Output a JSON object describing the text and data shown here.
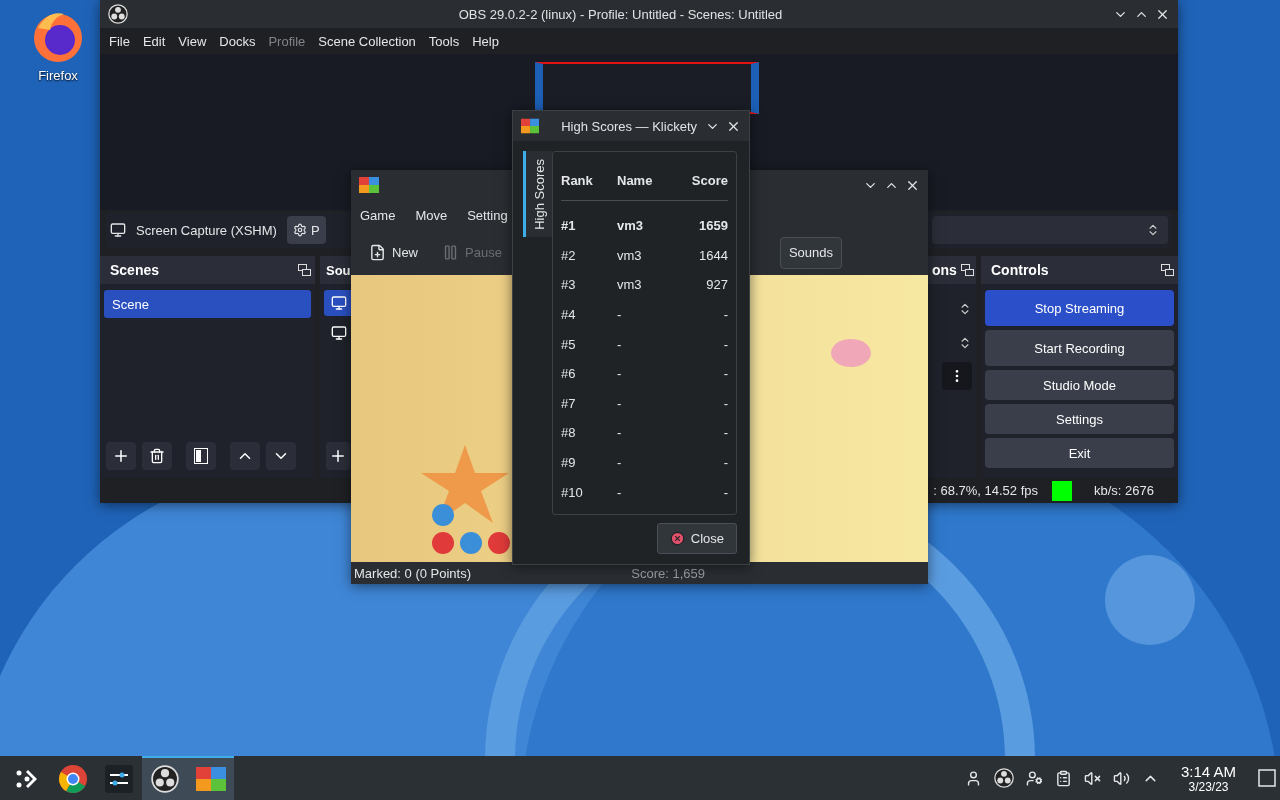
{
  "desktop": {
    "icons": [
      {
        "label": "Firefox"
      }
    ]
  },
  "obs": {
    "title": "OBS 29.0.2-2 (linux) - Profile: Untitled - Scenes: Untitled",
    "menu": [
      {
        "label": "File",
        "disabled": false
      },
      {
        "label": "Edit",
        "disabled": false
      },
      {
        "label": "View",
        "disabled": false
      },
      {
        "label": "Docks",
        "disabled": false
      },
      {
        "label": "Profile",
        "disabled": true
      },
      {
        "label": "Scene Collection",
        "disabled": false
      },
      {
        "label": "Tools",
        "disabled": false
      },
      {
        "label": "Help",
        "disabled": false
      }
    ],
    "source_toolbar": {
      "source": "Screen Capture (XSHM)",
      "properties": "P"
    },
    "scenes": {
      "title": "Scenes",
      "items": [
        {
          "label": "Scene",
          "selected": true
        }
      ]
    },
    "sources": {
      "title": "Sou",
      "items": [
        {
          "selected": true
        },
        {
          "selected": false
        }
      ]
    },
    "transitions": {
      "title": "ons"
    },
    "controls": {
      "title": "Controls",
      "buttons": [
        {
          "label": "Stop Streaming",
          "active": true
        },
        {
          "label": "Start Recording",
          "active": false
        },
        {
          "label": "Studio Mode",
          "active": false
        },
        {
          "label": "Settings",
          "active": false
        },
        {
          "label": "Exit",
          "active": false
        }
      ]
    },
    "status": {
      "performance": ": 68.7%, 14.52 fps",
      "bitrate": "kb/s: 2676"
    }
  },
  "klickety": {
    "menu": [
      "Game",
      "Move",
      "Setting"
    ],
    "toolbar": [
      {
        "label": "New",
        "disabled": false
      },
      {
        "label": "Pause",
        "disabled": true
      },
      {
        "label": "Sounds",
        "disabled": false
      }
    ],
    "status_left": "Marked: 0 (0 Points)",
    "status_right": "Score: 1,659"
  },
  "high_scores": {
    "title": "High Scores — Klickety",
    "tab": "High Scores",
    "columns": [
      "Rank",
      "Name",
      "Score"
    ],
    "rows": [
      {
        "rank": "#1",
        "name": "vm3",
        "score": "1659",
        "highlighted": true
      },
      {
        "rank": "#2",
        "name": "vm3",
        "score": "1644",
        "highlighted": false
      },
      {
        "rank": "#3",
        "name": "vm3",
        "score": "927",
        "highlighted": false
      },
      {
        "rank": "#4",
        "name": "-",
        "score": "-",
        "highlighted": false
      },
      {
        "rank": "#5",
        "name": "-",
        "score": "-",
        "highlighted": false
      },
      {
        "rank": "#6",
        "name": "-",
        "score": "-",
        "highlighted": false
      },
      {
        "rank": "#7",
        "name": "-",
        "score": "-",
        "highlighted": false
      },
      {
        "rank": "#8",
        "name": "-",
        "score": "-",
        "highlighted": false
      },
      {
        "rank": "#9",
        "name": "-",
        "score": "-",
        "highlighted": false
      },
      {
        "rank": "#10",
        "name": "-",
        "score": "-",
        "highlighted": false
      }
    ],
    "close": "Close"
  },
  "taskbar": {
    "apps": [
      {
        "kind": "launcher",
        "selected": false
      },
      {
        "kind": "browser",
        "selected": false
      },
      {
        "kind": "mixer",
        "selected": false
      },
      {
        "kind": "obs",
        "selected": true
      },
      {
        "kind": "klickety",
        "selected": true
      }
    ],
    "clock": {
      "time": "3:14 AM",
      "date": "3/23/23"
    }
  }
}
